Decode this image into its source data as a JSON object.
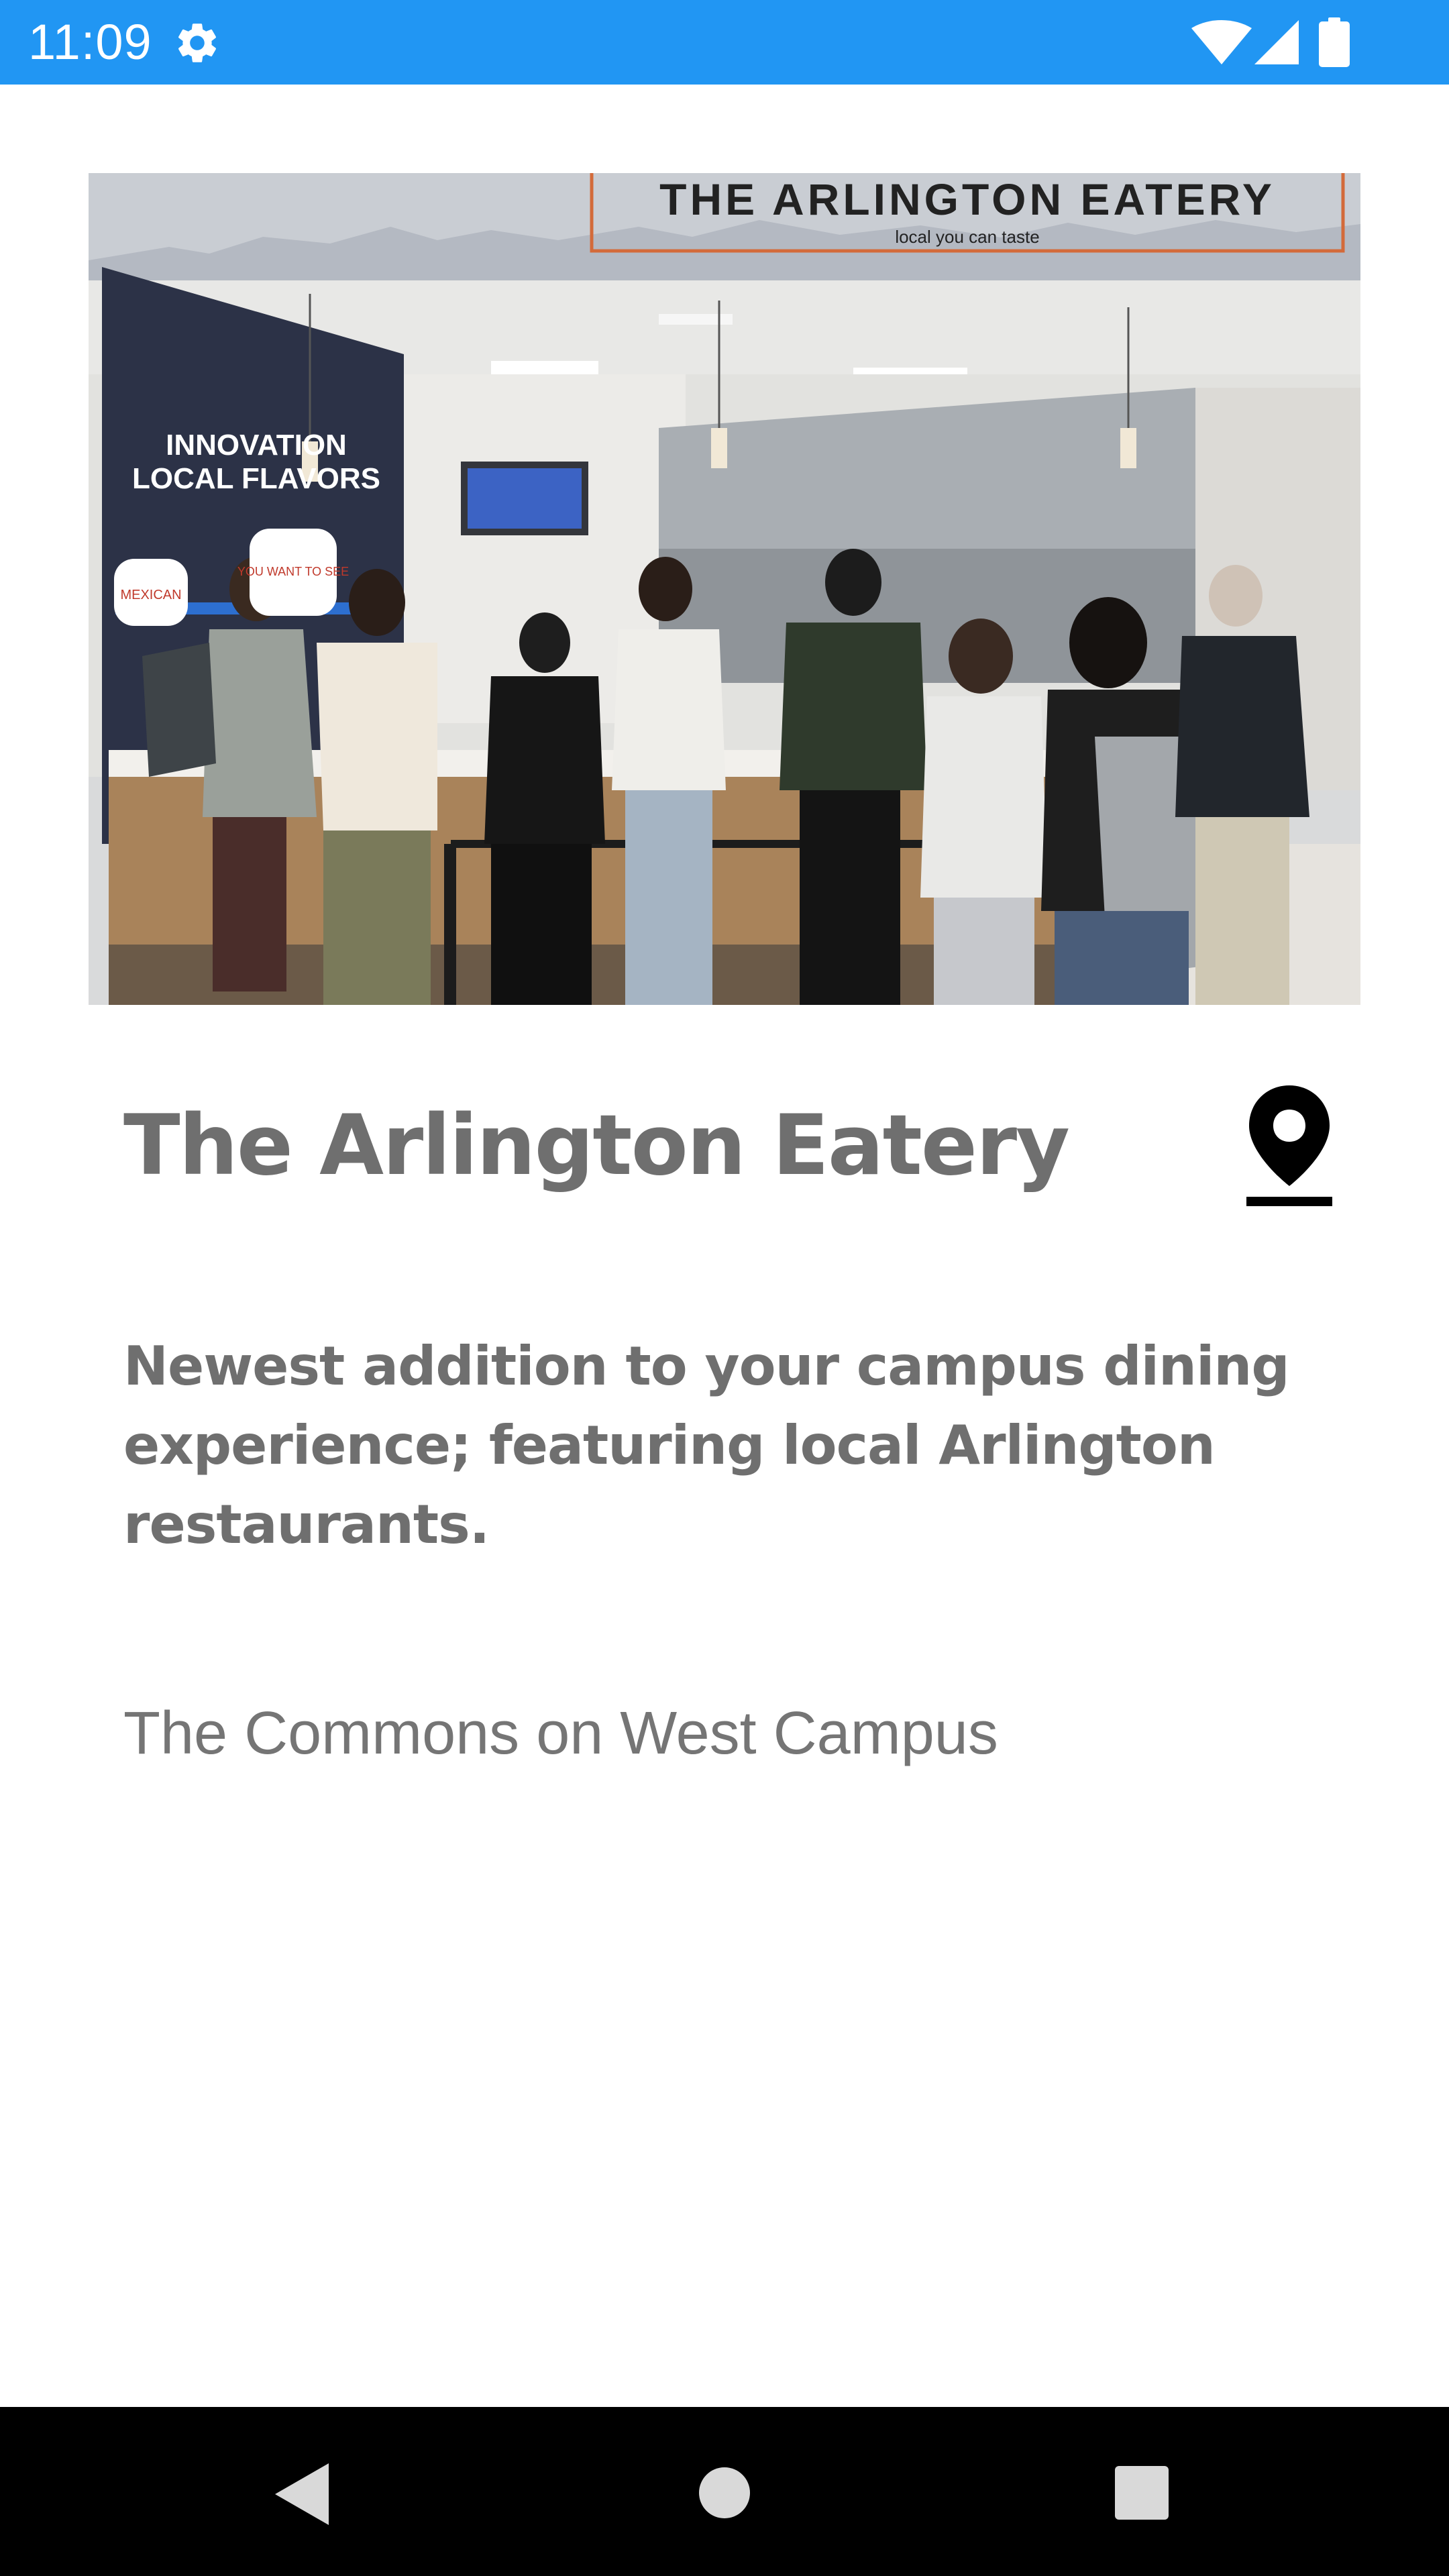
{
  "status_bar": {
    "time": "11:09",
    "color": "#2196f3",
    "icons": [
      "settings-gear-icon",
      "wifi-icon",
      "cell-signal-icon",
      "battery-icon"
    ]
  },
  "hero_image": {
    "description_icon": "restaurant-photo",
    "sign_title": "THE ARLINGTON EATERY",
    "sign_subtitle": "local you can taste",
    "wall_line1": "INNOVATION",
    "wall_line2": "LOCAL FLAVORS",
    "wall_bubble1": "MEXICAN",
    "wall_bubble2": "YOU WANT TO SEE"
  },
  "venue": {
    "title": "The Arlington Eatery",
    "description": "Newest addition to your campus dining experience; featuring local Arlington restaurants.",
    "location": "The Commons on West Campus",
    "map_icon": "location-pin-icon"
  },
  "nav_bar": {
    "buttons": [
      "back-button",
      "home-button",
      "recents-button"
    ]
  }
}
